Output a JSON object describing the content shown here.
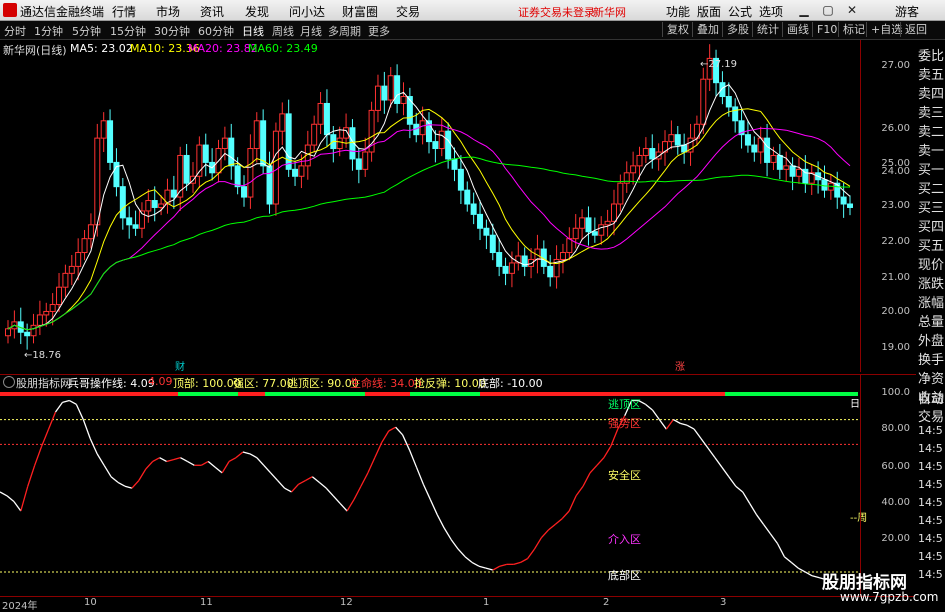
{
  "menubar": {
    "app_title": "通达信金融终端",
    "items": [
      "行情",
      "市场",
      "资讯",
      "发现",
      "问小达",
      "财富圈",
      "交易"
    ],
    "warning": "证券交易未登录",
    "stock": "新华网",
    "right_items": [
      "功能",
      "版面",
      "公式",
      "选项"
    ],
    "guest": "游客"
  },
  "toolbar": {
    "periods": [
      "分时",
      "1分钟",
      "5分钟",
      "15分钟",
      "30分钟",
      "60分钟",
      "日线",
      "周线",
      "月线",
      "多周期",
      "更多"
    ],
    "selected": "日线",
    "right_buttons": [
      "复权",
      "叠加",
      "多股",
      "统计",
      "画线",
      "F10",
      "标记",
      "+自选",
      "返回"
    ]
  },
  "main": {
    "stock_label": "新华网(日线)",
    "ma": [
      {
        "label": "MA5: 23.02",
        "color": "#ffffff"
      },
      {
        "label": "MA10: 23.36",
        "color": "#ffff00"
      },
      {
        "label": "MA20: 23.82",
        "color": "#ff00ff"
      },
      {
        "label": "MA60: 23.49",
        "color": "#00ff00"
      }
    ],
    "high_mark": "27.19",
    "low_mark": "18.76",
    "event_cai": "财",
    "event_zhang": "涨",
    "yticks": [
      "27.00",
      "26.00",
      "25.00",
      "24.00",
      "23.00",
      "22.00",
      "21.00",
      "20.00",
      "19.00"
    ]
  },
  "indicator": {
    "name": "股朋指标网",
    "items": [
      {
        "label": "兵哥操作线: 4.09",
        "color": "#ffffff"
      },
      {
        "label": "4.09",
        "color": "#ff3333"
      },
      {
        "label": "顶部: 100.00",
        "color": "#ffff66"
      },
      {
        "label": "强区: 77.00",
        "color": "#ffff66"
      },
      {
        "label": "逃顶区: 90.00",
        "color": "#ffff66"
      },
      {
        "label": "生命线: 34.00",
        "color": "#ff3333"
      },
      {
        "label": "抢反弹: 10.00",
        "color": "#ffff66"
      },
      {
        "label": "底部: -10.00",
        "color": "#ffffff"
      }
    ],
    "zones": {
      "taoding": "逃顶区",
      "qiangshi": "强势区",
      "anquan": "安全区",
      "jieru": "介入区",
      "dibu": "底部区",
      "zhou": "--周",
      "bai": "日"
    },
    "yticks": [
      "100.0",
      "80.00",
      "60.00",
      "40.00",
      "20.00"
    ]
  },
  "xaxis": [
    "2024年",
    "10",
    "11",
    "12",
    "1",
    "2",
    "3"
  ],
  "right_panel": {
    "items": [
      "委比",
      "卖五",
      "卖四",
      "卖三",
      "卖二",
      "卖一",
      "买一",
      "买二",
      "买三",
      "买四",
      "买五",
      "现价",
      "涨跌",
      "涨幅",
      "总量",
      "外盘",
      "换手",
      "净资",
      "收益"
    ],
    "items2": [
      "自动",
      "交易",
      "14:5",
      "14:5",
      "14:5",
      "14:5",
      "14:5",
      "14:5",
      "14:5",
      "14:5",
      "14:5"
    ]
  },
  "watermark": {
    "title": "股朋指标网",
    "url": "www.7gpzb.com"
  },
  "chart_data": {
    "type": "candlestick",
    "title": "新华网(日线)",
    "ylim": [
      18.5,
      27.5
    ],
    "closes": [
      19.4,
      19.6,
      19.3,
      19.2,
      19.5,
      19.8,
      19.9,
      20.1,
      20.6,
      21.0,
      21.2,
      21.6,
      22.0,
      22.4,
      24.9,
      25.4,
      24.2,
      23.5,
      22.6,
      22.4,
      22.3,
      22.8,
      23.1,
      22.9,
      23.0,
      23.4,
      23.2,
      24.4,
      23.6,
      23.8,
      24.7,
      24.2,
      23.9,
      24.6,
      24.9,
      24.1,
      23.5,
      23.2,
      24.6,
      25.4,
      24.1,
      23.0,
      25.1,
      25.6,
      24.0,
      23.8,
      24.1,
      24.7,
      25.3,
      25.9,
      25.0,
      24.6,
      24.9,
      25.2,
      24.3,
      24.0,
      24.5,
      25.7,
      26.4,
      26.0,
      26.7,
      25.9,
      26.1,
      25.3,
      25.0,
      25.4,
      24.8,
      24.6,
      25.1,
      24.3,
      24.0,
      23.4,
      23.0,
      22.7,
      22.3,
      22.1,
      21.6,
      21.2,
      21.0,
      21.3,
      21.5,
      21.2,
      21.4,
      21.7,
      21.2,
      20.9,
      21.4,
      21.6,
      22.0,
      22.3,
      22.6,
      22.2,
      22.1,
      22.4,
      22.5,
      23.0,
      23.6,
      23.9,
      24.1,
      24.4,
      24.6,
      24.3,
      24.5,
      24.8,
      25.0,
      24.7,
      24.5,
      24.9,
      25.3,
      26.6,
      27.2,
      26.5,
      26.1,
      25.8,
      25.4,
      25.0,
      24.7,
      24.5,
      24.9,
      24.2,
      24.4,
      24.0,
      24.1,
      23.8,
      24.0,
      23.6,
      23.9,
      23.7,
      23.4,
      23.6,
      23.2,
      23.0,
      22.9
    ],
    "ma_final": {
      "MA5": 23.02,
      "MA10": 23.36,
      "MA20": 23.82,
      "MA60": 23.49
    },
    "indicator_line": [
      52,
      50,
      47,
      42,
      55,
      66,
      76,
      85,
      94,
      99,
      100,
      98,
      90,
      80,
      72,
      66,
      60,
      57,
      55,
      54,
      58,
      64,
      68,
      70,
      68,
      69,
      70,
      68,
      66,
      66,
      68,
      65,
      62,
      68,
      70,
      73,
      72,
      70,
      66,
      62,
      58,
      54,
      52,
      56,
      58,
      60,
      57,
      54,
      50,
      46,
      42,
      48,
      55,
      62,
      70,
      78,
      84,
      86,
      82,
      74,
      65,
      56,
      48,
      40,
      33,
      27,
      22,
      18,
      15,
      13,
      12,
      11,
      13,
      14,
      14,
      15,
      17,
      22,
      28,
      32,
      35,
      38,
      42,
      50,
      55,
      62,
      66,
      70,
      76,
      85,
      92,
      100,
      100,
      98,
      95,
      90,
      85,
      90,
      88,
      87,
      85,
      80,
      75,
      70,
      65,
      60,
      55,
      52,
      46,
      40,
      35,
      30,
      25,
      18,
      15,
      12,
      10,
      8,
      7,
      6
    ],
    "indicator_ylim": [
      0,
      105
    ]
  }
}
